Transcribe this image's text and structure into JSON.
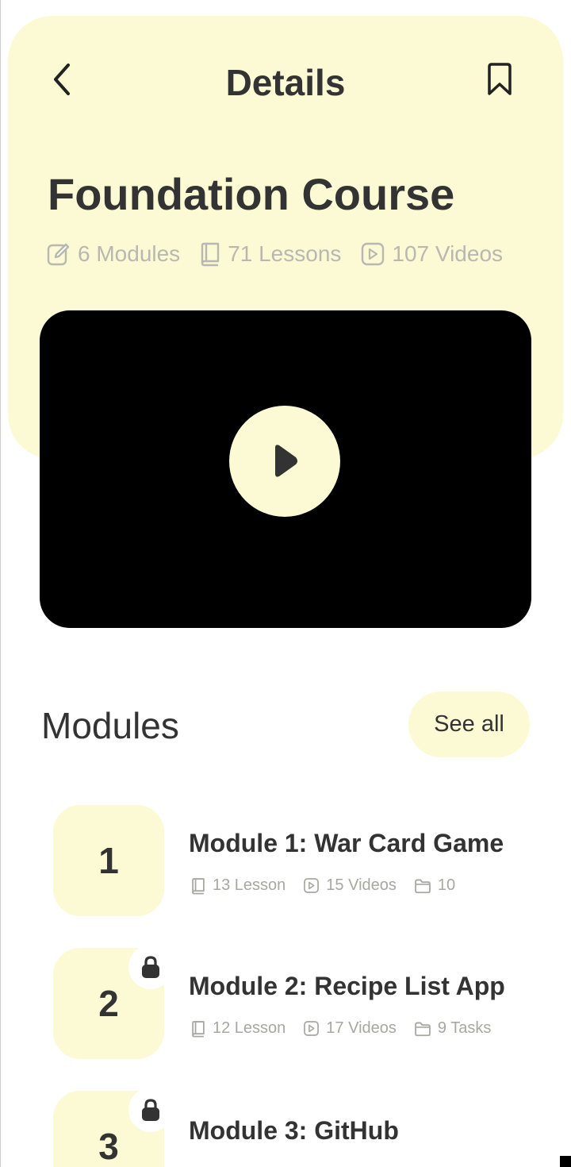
{
  "header": {
    "title": "Details"
  },
  "course": {
    "title": "Foundation Course",
    "stats": {
      "modules": "6 Modules",
      "lessons": "71 Lessons",
      "videos": "107 Videos"
    }
  },
  "modules_section": {
    "title": "Modules",
    "see_all_label": "See all",
    "items": [
      {
        "number": "1",
        "title": "Module 1: War Card Game",
        "lessons": "13 Lesson",
        "videos": "15 Videos",
        "tasks": "10",
        "locked": false
      },
      {
        "number": "2",
        "title": "Module 2: Recipe List App",
        "lessons": "12 Lesson",
        "videos": "17 Videos",
        "tasks": "9 Tasks",
        "locked": true
      },
      {
        "number": "3",
        "title": "Module 3: GitHub",
        "locked": true
      }
    ]
  },
  "colors": {
    "accent_bg": "#fcf9d5",
    "text_dark": "#333333",
    "text_muted": "#b8b8b0"
  },
  "icons": [
    "back-icon",
    "bookmark-icon",
    "edit-icon",
    "book-icon",
    "video-icon",
    "play-icon",
    "folder-icon",
    "lock-icon"
  ]
}
